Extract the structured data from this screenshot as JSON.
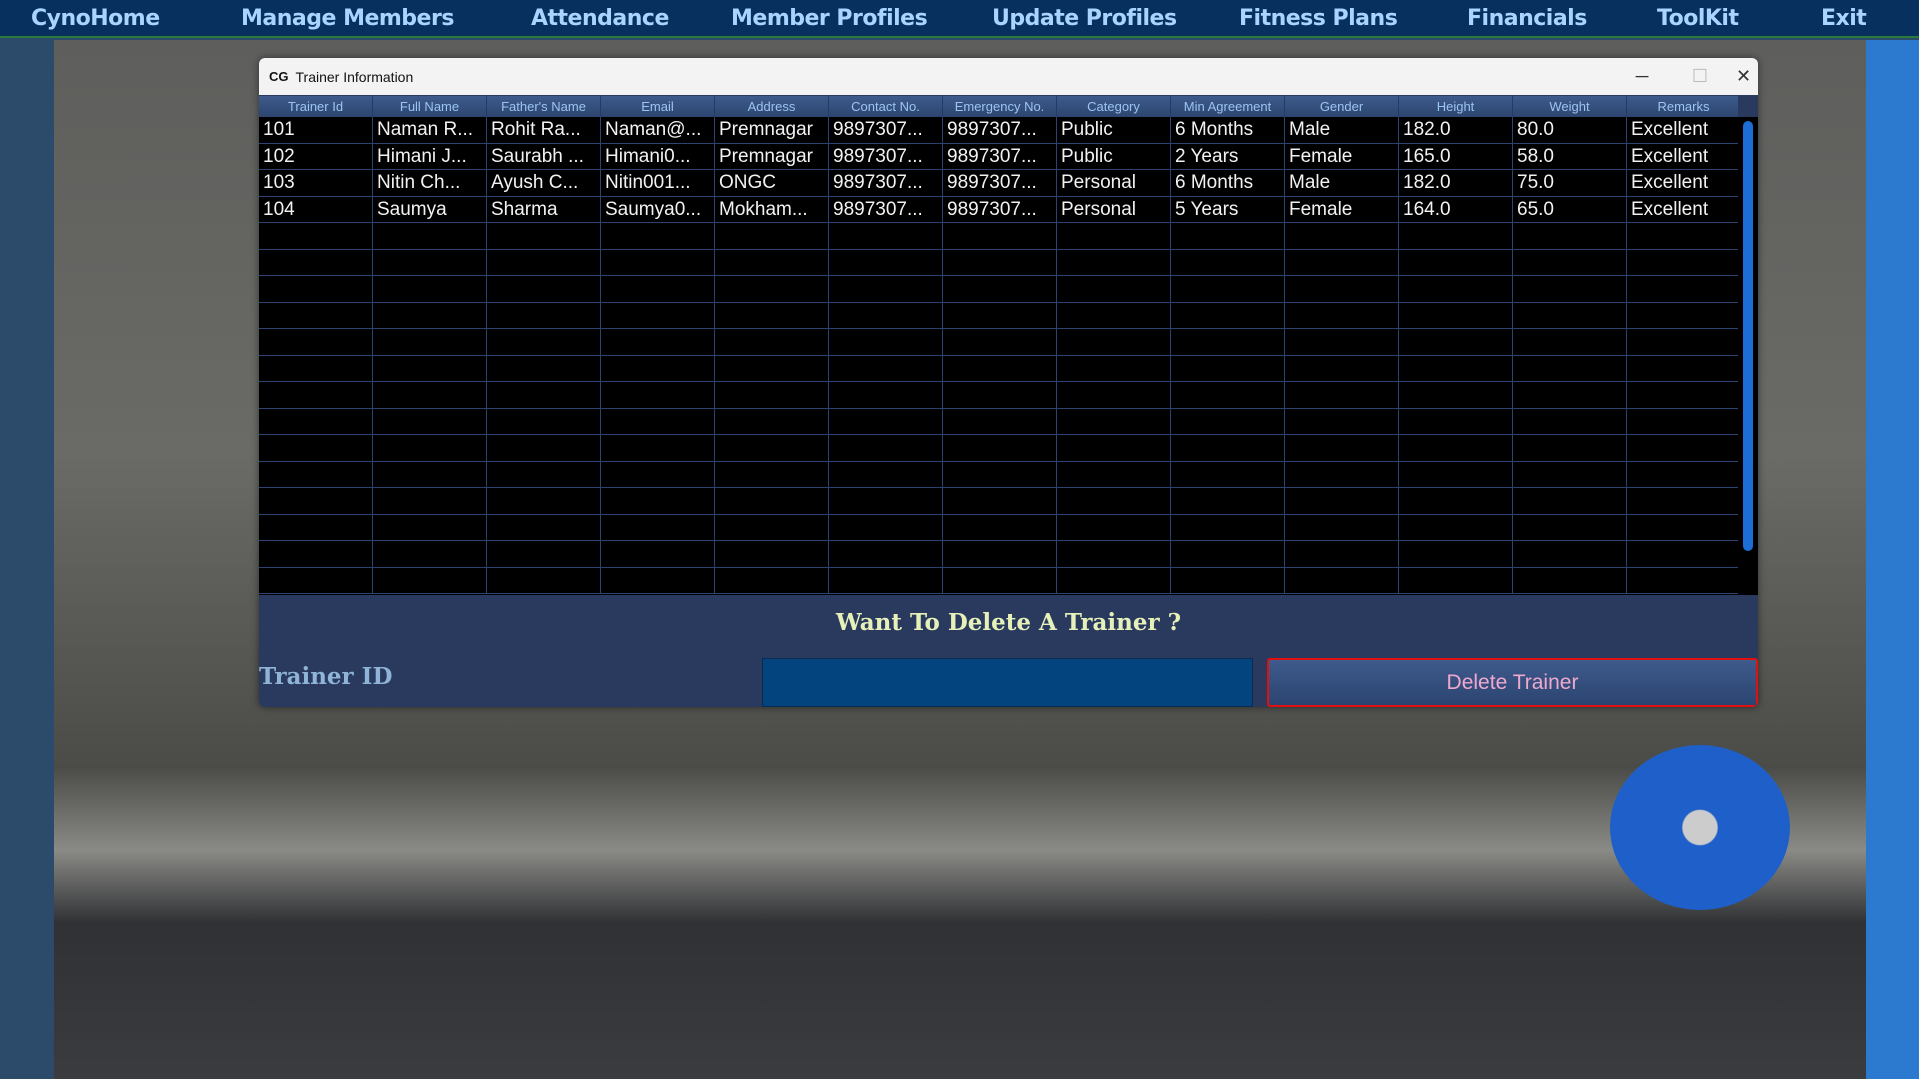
{
  "nav": {
    "items": [
      "CynoHome",
      "Manage Members",
      "Attendance",
      "Member Profiles",
      "Update Profiles",
      "Fitness Plans",
      "Financials",
      "ToolKit",
      "Exit"
    ]
  },
  "window": {
    "title": "Trainer Information",
    "icon": "cg-logo-icon",
    "minimize": "─",
    "maximize": "☐",
    "close": "✕"
  },
  "table": {
    "columns": [
      "Trainer Id",
      "Full Name",
      "Father's Name",
      "Email",
      "Address",
      "Contact No.",
      "Emergency No.",
      "Category",
      "Min Agreement",
      "Gender",
      "Height",
      "Weight",
      "Remarks"
    ],
    "rows": [
      [
        "101",
        "Naman R...",
        "Rohit Ra...",
        "Naman@...",
        "Premnagar",
        "9897307...",
        "9897307...",
        "Public",
        "6 Months",
        "Male",
        "182.0",
        "80.0",
        "Excellent"
      ],
      [
        "102",
        "Himani J...",
        "Saurabh ...",
        "Himani0...",
        "Premnagar",
        "9897307...",
        "9897307...",
        "Public",
        "2 Years",
        "Female",
        "165.0",
        "58.0",
        "Excellent"
      ],
      [
        "103",
        "Nitin Ch...",
        "Ayush C...",
        "Nitin001...",
        "ONGC",
        "9897307...",
        "9897307...",
        "Personal",
        "6 Months",
        "Male",
        "182.0",
        "75.0",
        "Excellent"
      ],
      [
        "104",
        "Saumya",
        "Sharma",
        "Saumya0...",
        "Mokham...",
        "9897307...",
        "9897307...",
        "Personal",
        "5 Years",
        "Female",
        "164.0",
        "65.0",
        "Excellent"
      ]
    ]
  },
  "delete": {
    "question": "Want To Delete A Trainer ?",
    "label": "Trainer ID",
    "input_value": "",
    "button": "Delete Trainer"
  },
  "colors": {
    "nav_bg": "#08305f",
    "nav_text": "#a8d4ff",
    "panel_bg": "#293a5e",
    "button_border": "#e01010"
  }
}
